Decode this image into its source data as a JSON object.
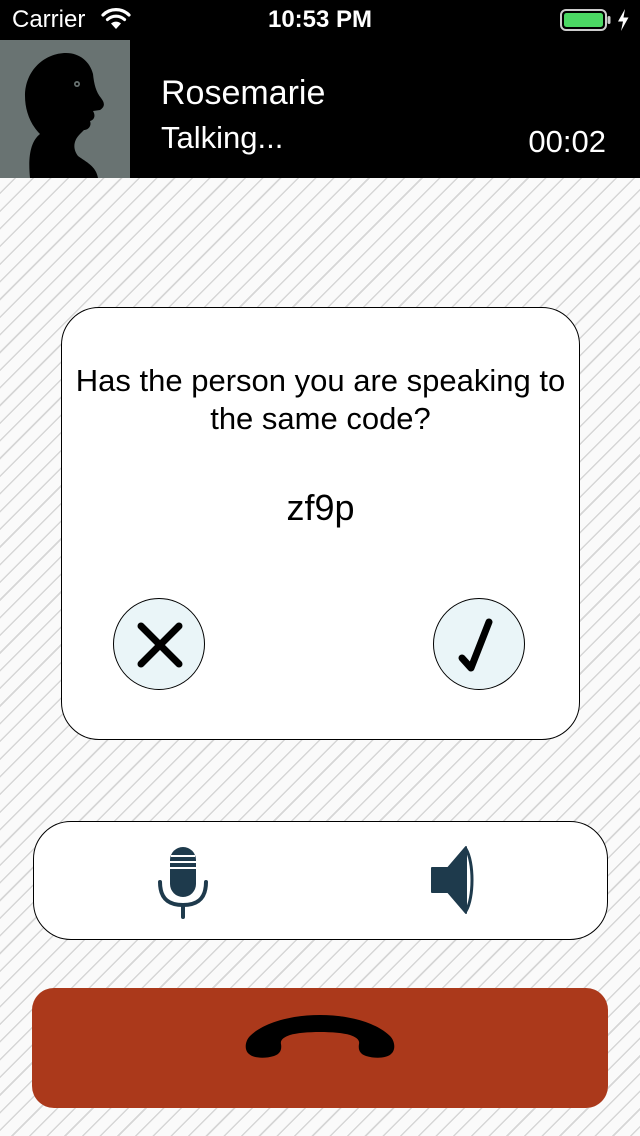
{
  "status_bar": {
    "carrier": "Carrier",
    "time": "10:53 PM",
    "wifi_icon": "wifi-icon",
    "battery_icon": "battery-icon",
    "charging_icon": "charging-bolt-icon",
    "battery_color": "#4cd964"
  },
  "call": {
    "caller_name": "Rosemarie",
    "status": "Talking...",
    "duration": "00:02",
    "avatar_icon": "person-silhouette-icon",
    "avatar_background": "#697372"
  },
  "verification": {
    "question": "Has the person you are speaking to the same code?",
    "code": "zf9p",
    "reject_icon": "close-icon",
    "confirm_icon": "checkmark-icon",
    "button_background": "#eaf5f8"
  },
  "controls": {
    "microphone_icon": "microphone-icon",
    "speaker_icon": "speaker-icon",
    "icon_color": "#1e3a4c"
  },
  "end_call": {
    "icon": "hang-up-phone-icon",
    "background": "#ab391b"
  }
}
